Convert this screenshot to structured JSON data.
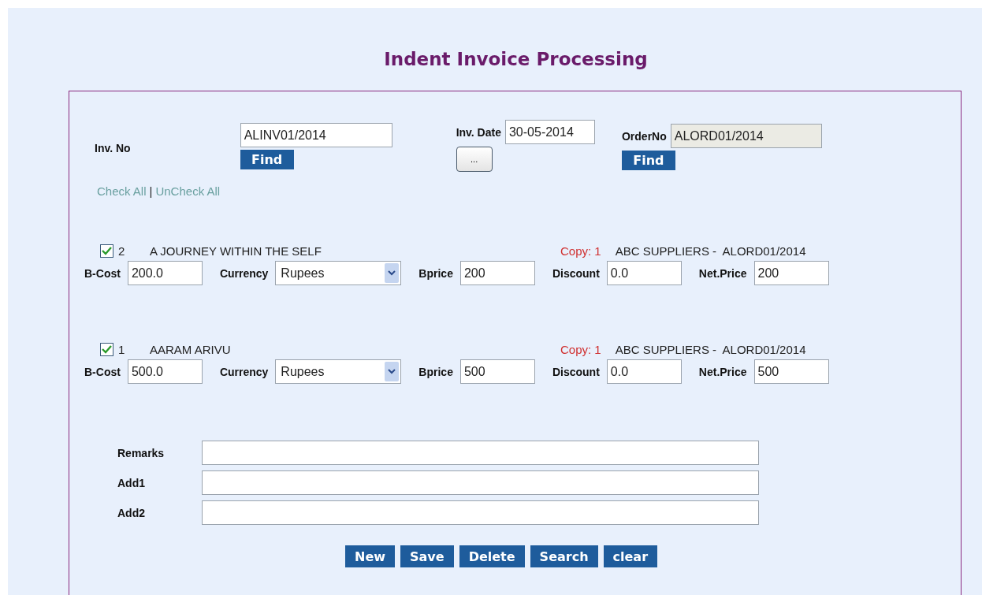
{
  "title": "Indent Invoice Processing",
  "invoice": {
    "label": "Inv. No",
    "value": "ALINV01/2014",
    "find": "Find"
  },
  "date": {
    "label": "Inv. Date",
    "value": "30-05-2014",
    "picker": "..."
  },
  "order": {
    "label": "OrderNo",
    "value": "ALORD01/2014",
    "disabled": true,
    "find": "Find"
  },
  "check_links": {
    "check_all": "Check All",
    "separator": "|",
    "uncheck_all": "UnCheck All"
  },
  "items": [
    {
      "checked": true,
      "number": "2",
      "title": "A JOURNEY WITHIN THE SELF",
      "copy": "Copy: 1",
      "supplier": "ABC SUPPLIERS -  ALORD01/2014",
      "fields": [
        {
          "kind": "text",
          "label": "B-Cost",
          "value": "200.0"
        },
        {
          "kind": "select",
          "label": "Currency",
          "value": "Rupees"
        },
        {
          "kind": "text",
          "label": "Bprice",
          "value": "200"
        },
        {
          "kind": "text",
          "label": "Discount",
          "value": "0.0"
        },
        {
          "kind": "text",
          "label": "Net.Price",
          "value": "200"
        }
      ]
    },
    {
      "checked": true,
      "number": "1",
      "title": "AARAM ARIVU",
      "copy": "Copy: 1",
      "supplier": "ABC SUPPLIERS -  ALORD01/2014",
      "fields": [
        {
          "kind": "text",
          "label": "B-Cost",
          "value": "500.0"
        },
        {
          "kind": "select",
          "label": "Currency",
          "value": "Rupees"
        },
        {
          "kind": "text",
          "label": "Bprice",
          "value": "500"
        },
        {
          "kind": "text",
          "label": "Discount",
          "value": "0.0"
        },
        {
          "kind": "text",
          "label": "Net.Price",
          "value": "500"
        }
      ]
    }
  ],
  "remarks": [
    {
      "label": "Remarks"
    },
    {
      "label": "Add1"
    },
    {
      "label": "Add2"
    }
  ],
  "buttons": [
    "New",
    "Save",
    "Delete",
    "Search",
    "clear"
  ]
}
